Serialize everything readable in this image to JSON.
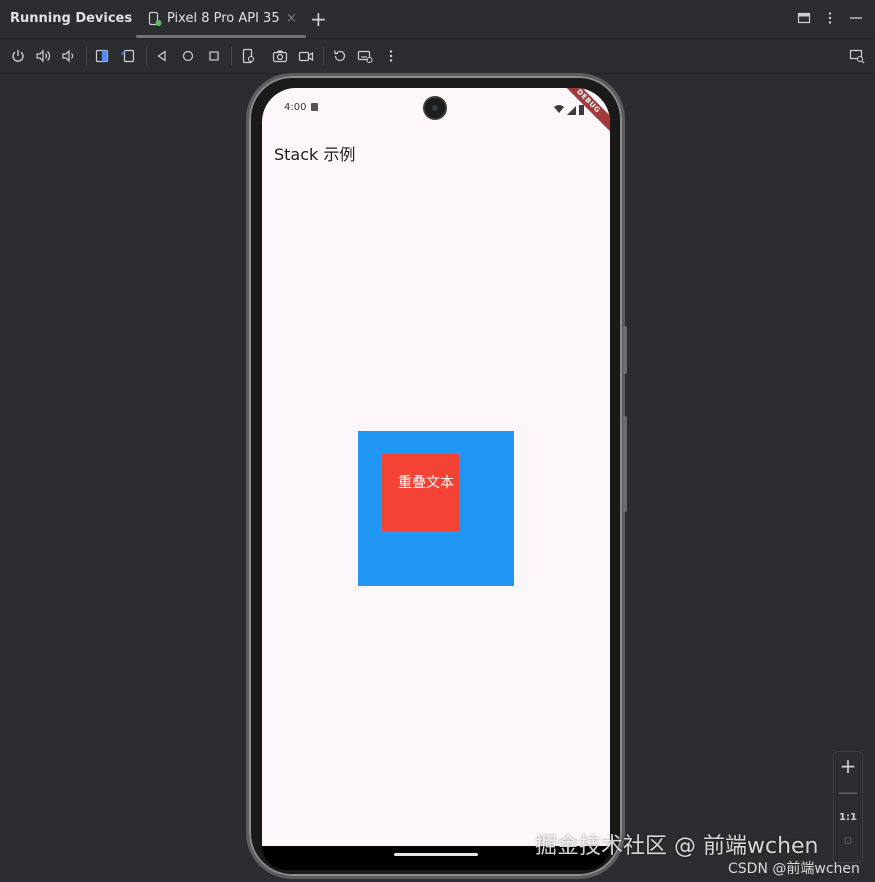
{
  "panel": {
    "title": "Running Devices"
  },
  "tab": {
    "label": "Pixel 8 Pro API 35",
    "close": "×",
    "add": "+"
  },
  "toolbar": {
    "icons": [
      "power-icon",
      "volume-up-icon",
      "volume-down-icon",
      "rotate-left-icon",
      "rotate-right-icon",
      "back-icon",
      "home-icon",
      "overview-icon",
      "device-state-icon",
      "screenshot-icon",
      "screen-record-icon",
      "reset-icon",
      "keyboard-icon",
      "more-icon",
      "device-mirror-icon"
    ]
  },
  "phone": {
    "status_time": "4:00",
    "debug_banner": "DEBUG",
    "app_title": "Stack 示例",
    "overlap_text": "重叠文本",
    "colors": {
      "background": "#fdf7fb",
      "blue_box": "#2196f3",
      "red_box": "#f44336"
    }
  },
  "zoom": {
    "zoom_in": "+",
    "zoom_out": "—",
    "actual": "1:1",
    "fit": "⊡"
  },
  "watermark": {
    "line1": "掘金技术社区 @ 前端wchen",
    "line2": "CSDN @前端wchen"
  }
}
